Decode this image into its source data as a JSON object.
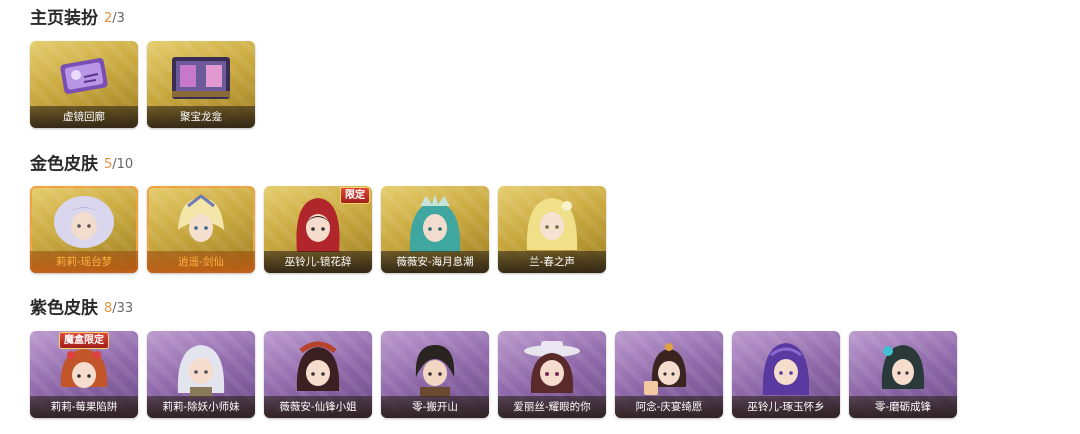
{
  "home_decor": {
    "title": "主页装扮",
    "count_current": "2",
    "count_total": "/3",
    "items": [
      {
        "label": "虚镜回廊",
        "icon": "ticket-art-icon"
      },
      {
        "label": "聚宝龙龛",
        "icon": "shrine-art-icon"
      }
    ]
  },
  "gold_skins": {
    "title": "金色皮肤",
    "count_current": "5",
    "count_total": "/10",
    "items": [
      {
        "label": "莉莉-瑶台梦",
        "selected": true
      },
      {
        "label": "逍遥-剑仙",
        "selected": true
      },
      {
        "label": "巫铃儿-镜花辞",
        "badge": "限定"
      },
      {
        "label": "薇薇安-海月息潮"
      },
      {
        "label": "兰-春之声"
      }
    ]
  },
  "purple_skins": {
    "title": "紫色皮肤",
    "count_current": "8",
    "count_total": "/33",
    "items": [
      {
        "label": "莉莉-莓果陷阱",
        "badge": "魔盒限定"
      },
      {
        "label": "莉莉-除妖小师妹"
      },
      {
        "label": "薇薇安-仙锋小姐"
      },
      {
        "label": "零-搬开山"
      },
      {
        "label": "爱丽丝-耀眼的你"
      },
      {
        "label": "阿念-庆宴绮愿"
      },
      {
        "label": "巫铃儿-琢玉怀乡"
      },
      {
        "label": "零-磨砺成锋"
      }
    ]
  },
  "colors": {
    "accent_orange": "#e8913a",
    "gold_card": "#c9a93f",
    "purple_card": "#8f69aa"
  }
}
